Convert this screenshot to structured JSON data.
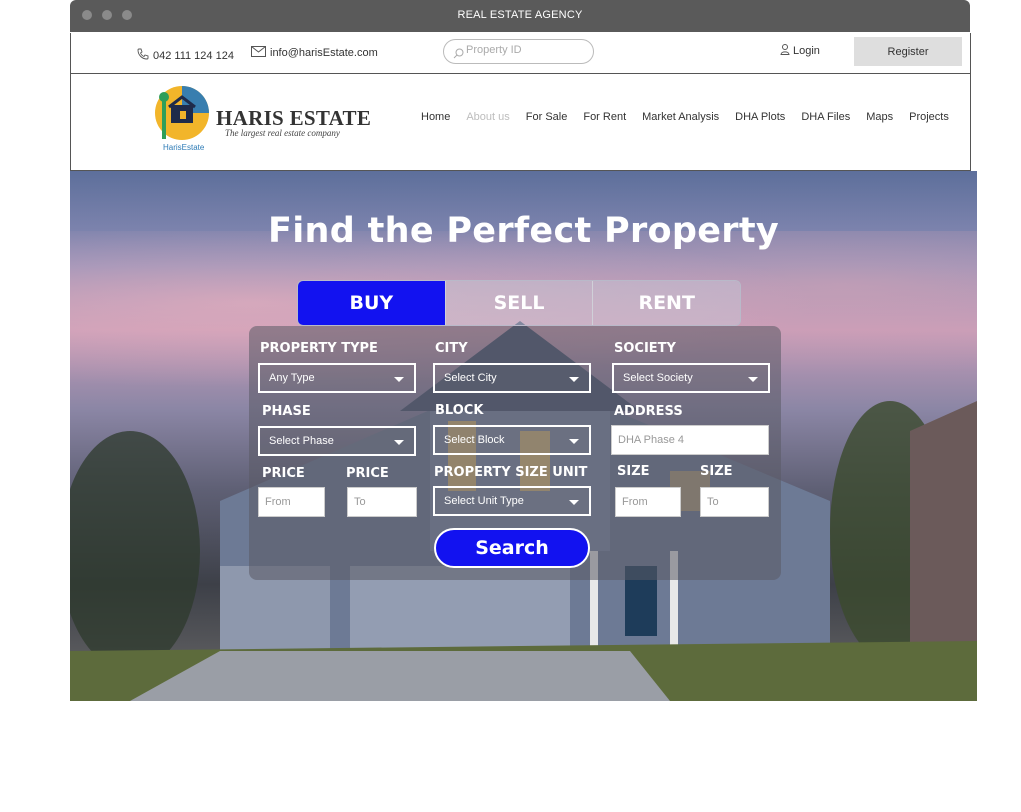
{
  "window": {
    "title": "REAL ESTATE AGENCY"
  },
  "topbar": {
    "phone": "042 111 124 124",
    "email": "info@harisEstate.com",
    "search_placeholder": "Property ID",
    "login_label": "Login",
    "register_label": "Register"
  },
  "brand": {
    "name": "HARIS ESTATE",
    "tagline": "The largest real estate company",
    "small_name": "HarisEstate"
  },
  "nav": {
    "items": [
      {
        "label": "Home"
      },
      {
        "label": "About us"
      },
      {
        "label": "For Sale"
      },
      {
        "label": "For Rent"
      },
      {
        "label": "Market Analysis"
      },
      {
        "label": "DHA Plots"
      },
      {
        "label": "DHA Files"
      },
      {
        "label": "Maps"
      },
      {
        "label": "Projects"
      }
    ]
  },
  "hero": {
    "title": "Find the Perfect Property",
    "tabs": [
      {
        "label": "BUY"
      },
      {
        "label": "SELL"
      },
      {
        "label": "RENT"
      }
    ],
    "active_tab": "BUY"
  },
  "form": {
    "property_type": {
      "label": "PROPERTY TYPE",
      "value": "Any Type"
    },
    "city": {
      "label": "CITY",
      "value": "Select City"
    },
    "society": {
      "label": "SOCIETY",
      "value": "Select Society"
    },
    "phase": {
      "label": "PHASE",
      "value": "Select Phase"
    },
    "block": {
      "label": "BLOCK",
      "value": "Select Block"
    },
    "address": {
      "label": "ADDRESS",
      "placeholder": "DHA Phase 4"
    },
    "price_from": {
      "label": "PRICE",
      "placeholder": "From"
    },
    "price_to": {
      "label": "PRICE",
      "placeholder": "To"
    },
    "size_unit": {
      "label": "PROPERTY SIZE UNIT",
      "value": "Select Unit Type"
    },
    "size_from": {
      "label": "SIZE",
      "placeholder": "From"
    },
    "size_to": {
      "label": "SIZE",
      "placeholder": "To"
    },
    "search_label": "Search"
  },
  "colors": {
    "accent": "#1212f0",
    "titlebar": "#5a5a5a",
    "register_bg": "#dedede"
  }
}
